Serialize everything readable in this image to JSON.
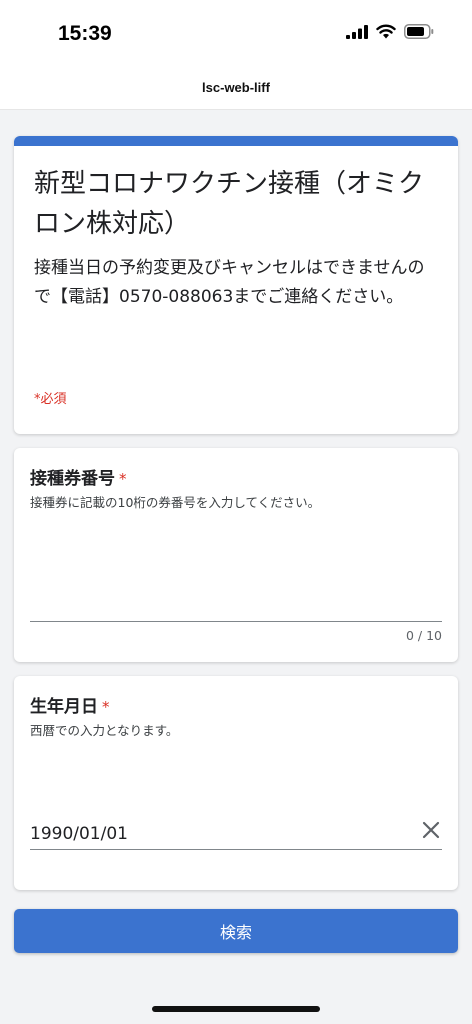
{
  "status_bar": {
    "time": "15:39"
  },
  "nav": {
    "title": "lsc-web-liff"
  },
  "form": {
    "title": "新型コロナワクチン接種（オミクロン株対応）",
    "description": "接種当日の予約変更及びキャンセルはできませんので【電話】0570-088063までご連絡ください。",
    "required_note": "*必須"
  },
  "questions": [
    {
      "title": "接種券番号",
      "required_mark": "*",
      "description": "接種券に記載の10桁の券番号を入力してください。",
      "value": "",
      "counter": "0 / 10"
    },
    {
      "title": "生年月日",
      "required_mark": "*",
      "description": "西暦での入力となります。",
      "value": "1990/01/01"
    }
  ],
  "search_button": {
    "label": "検索"
  },
  "colors": {
    "accent": "#3b73cf",
    "required": "#d93025",
    "background": "#f2f3f5"
  }
}
